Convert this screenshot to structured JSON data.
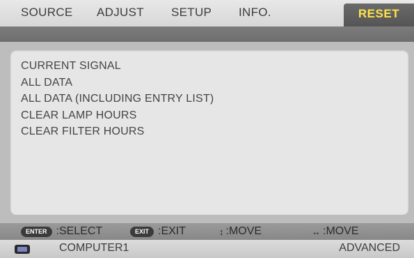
{
  "tabs": {
    "source": "SOURCE",
    "adjust": "ADJUST",
    "setup": "SETUP",
    "info": "INFO.",
    "reset": "RESET"
  },
  "menu": {
    "items": [
      "CURRENT SIGNAL",
      "ALL DATA",
      "ALL DATA (INCLUDING ENTRY LIST)",
      "CLEAR LAMP HOURS",
      "CLEAR FILTER HOURS"
    ]
  },
  "help": {
    "enter_key": "ENTER",
    "enter_text": ":SELECT",
    "exit_key": "EXIT",
    "exit_text": ":EXIT",
    "updown_icon": "↕",
    "updown_text": ":MOVE",
    "leftright_icon": "↔",
    "leftright_text": ":MOVE"
  },
  "status": {
    "source": "COMPUTER1",
    "mode": "ADVANCED"
  },
  "colors": {
    "active_tab_text": "#ffe34a",
    "active_tab_bg": "#5e5e5e"
  }
}
